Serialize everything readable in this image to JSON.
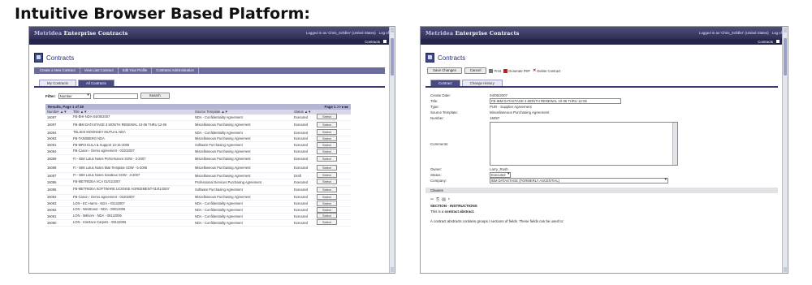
{
  "heading": "Intuitive Browser Based Platform:",
  "app": {
    "brand": "Enterprise Contracts",
    "brand_mark": "Metridea",
    "logged_in": "Logged in as 'Chris_Schiller' (United States)",
    "logoff": "Log off",
    "menu": "Contracts"
  },
  "left": {
    "page_title": "Contracts",
    "actions": [
      "Create a New Contract",
      "View Last Contract",
      "Edit Your Profile",
      "Contracts Administration"
    ],
    "tabs": [
      "My Contracts",
      "All Contracts"
    ],
    "filter_label": "Filter:",
    "filter_value": "Number",
    "search_button": "Search",
    "results_title": "Results, Page 1 of 39",
    "page_indicator": "Page 1 >> ▸ ▸▸",
    "columns": [
      "Number ▲▼",
      "Title ▲▼",
      "Source Template ▲▼",
      "Status ▲▼",
      ""
    ],
    "select_label": "Select",
    "rows": [
      [
        "16097",
        "FB-BHI-NDA-04/05/2007",
        "NDA - Confidentiality Agreement",
        "Executed"
      ],
      [
        "16097",
        "FB-IBM DATASTAGE 3 MONTH RENEWAL 10-06 THRU 12-06",
        "Miscellaneous Purchasing Agreement",
        "Executed"
      ],
      [
        "16094",
        "TELIKIS MOONSEY MUTUAL NDA",
        "NDA - Confidentiality Agreement",
        "Executed"
      ],
      [
        "16093",
        "FB-TANDBERG NDA",
        "Miscellaneous Purchasing Agreement",
        "Executed"
      ],
      [
        "16091",
        "FB-MRO EULA & Support 12-15-2006",
        "Software Purchasing Agreement",
        "Executed"
      ],
      [
        "16084",
        "FB-Canon - Demo agreement - 02202007",
        "Miscellaneous Purchasing Agreement",
        "Executed"
      ],
      [
        "16089",
        "FI - IBM Lotus Notes Performance SOW - 3-2007",
        "Miscellaneous Purchasing Agreement",
        "Executed"
      ],
      [
        "16088",
        "FI - IBM Lotus Notes Mail Template SOW - 5-2006",
        "Miscellaneous Purchasing Agreement",
        "Executed"
      ],
      [
        "16087",
        "FI - IBM Lotus Notes Sandbox SOW - 3-2007",
        "Miscellaneous Purchasing Agreement",
        "Draft"
      ],
      [
        "16086",
        "FB-METRIDEA VCA 01/01/2007",
        "Professional Services Purchasing Agreement",
        "Executed"
      ],
      [
        "16085",
        "FB-METRIDEA SOFTWARE LICENSE AGREEMENT-01/01/2007",
        "Software Purchasing Agreement",
        "Executed"
      ],
      [
        "16084",
        "FB-Canon - Demo agreement - 02202007",
        "Miscellaneous Purchasing Agreement",
        "Executed"
      ],
      [
        "16083",
        "LON - EC Harris - NDA - 03132007",
        "NDA - Confidentiality Agreement",
        "Executed"
      ],
      [
        "16082",
        "LON - Westbond - NDA - 09012006",
        "NDA - Confidentiality Agreement",
        "Executed"
      ],
      [
        "16081",
        "LON - Millsom - NDA - 09122006",
        "NDA - Confidentiality Agreement",
        "Executed"
      ],
      [
        "16080",
        "LON - Interface Carpets - 09122006",
        "NDA - Confidentiality Agreement",
        "Executed"
      ]
    ]
  },
  "right": {
    "page_title": "Contracts",
    "buttons": [
      "Save Changes",
      "Cancel"
    ],
    "tools": [
      "Print",
      "Generate PDF",
      "Delete Contract"
    ],
    "tabs": [
      "Contract",
      "Change History"
    ],
    "fields": {
      "create_date_label": "Create Date:",
      "create_date": "04/05/2007",
      "title_label": "Title:",
      "title": "FB-IBM DATASTAGE 3 MONTH RENEWAL 10-06 THRU 12-06",
      "type_label": "Type:",
      "type": "PUR - Supplier Agreement",
      "source_label": "Source Template:",
      "source": "Miscellaneous Purchasing Agreement",
      "number_label": "Number:",
      "number": "16097",
      "comments_label": "Comments:",
      "owner_label": "Owner:",
      "owner": "Larry_Rush",
      "status_label": "Status:",
      "status": "Executed",
      "company_label": "Company:",
      "company": "IBM DATASTAGE (FORMERLY ASCENTIAL)"
    },
    "clauses_label": "Clauses",
    "section_title": "SECTION - INSTRUCTIONS",
    "para1_prefix": "This is a ",
    "para1_bold": "contract abstract.",
    "para2": "A contract abstracts contains groups / sections of fields. These fields can be used to:"
  }
}
